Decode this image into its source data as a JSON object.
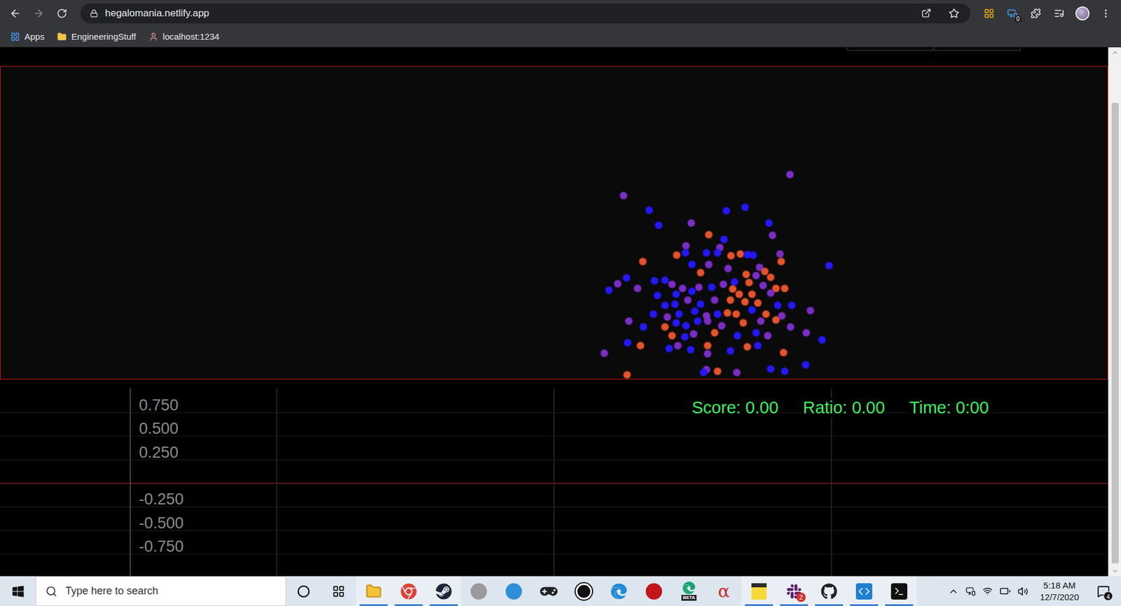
{
  "browser": {
    "url": "hegalomania.netlify.app",
    "extension_badge": "0",
    "bookmarks": [
      {
        "label": "Apps",
        "kind": "apps"
      },
      {
        "label": "EngineeringStuff",
        "kind": "folder"
      },
      {
        "label": "localhost:1234",
        "kind": "site"
      }
    ]
  },
  "page": {
    "top_buttons": 2
  },
  "simulation": {
    "particles": [
      [
        1105,
        152,
        "#7a2ec4"
      ],
      [
        872,
        181,
        "#7a2ec4"
      ],
      [
        908,
        202,
        "#2418f5"
      ],
      [
        1016,
        203,
        "#2418f5"
      ],
      [
        1042,
        198,
        "#2418f5"
      ],
      [
        921,
        223,
        "#2418f5"
      ],
      [
        967,
        220,
        "#7a2ec4"
      ],
      [
        1076,
        220,
        "#2418f5"
      ],
      [
        1081,
        237,
        "#7a2ec4"
      ],
      [
        992,
        236,
        "#e4532c"
      ],
      [
        1013,
        243,
        "#2418f5"
      ],
      [
        960,
        252,
        "#7a2ec4"
      ],
      [
        1007,
        254,
        "#7a2ec4"
      ],
      [
        988,
        262,
        "#2418f5"
      ],
      [
        1004,
        262,
        "#2418f5"
      ],
      [
        947,
        265,
        "#e4532c"
      ],
      [
        959,
        262,
        "#2418f5"
      ],
      [
        1023,
        266,
        "#e4532c"
      ],
      [
        1036,
        263,
        "#e4532c"
      ],
      [
        1054,
        265,
        "#2418f5"
      ],
      [
        1046,
        264,
        "#2418f5"
      ],
      [
        1091,
        263,
        "#7a2ec4"
      ],
      [
        1093,
        274,
        "#e4532c"
      ],
      [
        899,
        274,
        "#e4532c"
      ],
      [
        1160,
        280,
        "#2418f5"
      ],
      [
        968,
        278,
        "#2418f5"
      ],
      [
        992,
        278,
        "#7a2ec4"
      ],
      [
        1019,
        284,
        "#7a2ec4"
      ],
      [
        1063,
        282,
        "#7a2ec4"
      ],
      [
        1070,
        288,
        "#e4532c"
      ],
      [
        980,
        290,
        "#e4532c"
      ],
      [
        1044,
        292,
        "#e4532c"
      ],
      [
        1058,
        294,
        "#7a2ec4"
      ],
      [
        1078,
        296,
        "#e4532c"
      ],
      [
        876,
        297,
        "#2418f5"
      ],
      [
        864,
        305,
        "#7a2ec4"
      ],
      [
        852,
        314,
        "#2418f5"
      ],
      [
        892,
        312,
        "#7a2ec4"
      ],
      [
        916,
        301,
        "#2418f5"
      ],
      [
        930,
        300,
        "#2418f5"
      ],
      [
        940,
        306,
        "#7a2ec4"
      ],
      [
        955,
        312,
        "#7a2ec4"
      ],
      [
        968,
        316,
        "#2418f5"
      ],
      [
        978,
        310,
        "#7a2ec4"
      ],
      [
        996,
        310,
        "#2418f5"
      ],
      [
        1012,
        306,
        "#7a2ec4"
      ],
      [
        1028,
        303,
        "#2418f5"
      ],
      [
        1048,
        304,
        "#e4532c"
      ],
      [
        1068,
        308,
        "#7a2ec4"
      ],
      [
        1086,
        312,
        "#e4532c"
      ],
      [
        1098,
        312,
        "#e4532c"
      ],
      [
        1025,
        313,
        "#e4532c"
      ],
      [
        1034,
        320,
        "#e4532c"
      ],
      [
        1052,
        320,
        "#e4532c"
      ],
      [
        1078,
        318,
        "#7a2ec4"
      ],
      [
        920,
        322,
        "#2418f5"
      ],
      [
        946,
        320,
        "#2418f5"
      ],
      [
        930,
        336,
        "#2418f5"
      ],
      [
        944,
        334,
        "#2418f5"
      ],
      [
        962,
        328,
        "#7a2ec4"
      ],
      [
        980,
        334,
        "#2418f5"
      ],
      [
        1000,
        328,
        "#7a2ec4"
      ],
      [
        1022,
        328,
        "#e4532c"
      ],
      [
        1042,
        331,
        "#e4532c"
      ],
      [
        1060,
        332,
        "#e4532c"
      ],
      [
        1088,
        336,
        "#2418f5"
      ],
      [
        1108,
        336,
        "#2418f5"
      ],
      [
        1134,
        343,
        "#7a2ec4"
      ],
      [
        914,
        348,
        "#2418f5"
      ],
      [
        934,
        352,
        "#7a2ec4"
      ],
      [
        950,
        348,
        "#2418f5"
      ],
      [
        972,
        344,
        "#2418f5"
      ],
      [
        988,
        350,
        "#7a2ec4"
      ],
      [
        1004,
        348,
        "#2418f5"
      ],
      [
        1018,
        346,
        "#e4532c"
      ],
      [
        1030,
        348,
        "#e4532c"
      ],
      [
        1052,
        342,
        "#2418f5"
      ],
      [
        1072,
        348,
        "#e4532c"
      ],
      [
        1094,
        350,
        "#7a2ec4"
      ],
      [
        880,
        358,
        "#7a2ec4"
      ],
      [
        900,
        366,
        "#2418f5"
      ],
      [
        930,
        366,
        "#e4532c"
      ],
      [
        946,
        360,
        "#2418f5"
      ],
      [
        960,
        364,
        "#2418f5"
      ],
      [
        976,
        358,
        "#2418f5"
      ],
      [
        990,
        358,
        "#7a2ec4"
      ],
      [
        1010,
        364,
        "#7a2ec4"
      ],
      [
        1040,
        360,
        "#e4532c"
      ],
      [
        1064,
        358,
        "#7a2ec4"
      ],
      [
        1086,
        356,
        "#e4532c"
      ],
      [
        1106,
        366,
        "#7a2ec4"
      ],
      [
        1128,
        374,
        "#7a2ec4"
      ],
      [
        940,
        378,
        "#e4532c"
      ],
      [
        958,
        380,
        "#2418f5"
      ],
      [
        970,
        376,
        "#7a2ec4"
      ],
      [
        1000,
        374,
        "#e4532c"
      ],
      [
        1032,
        378,
        "#2418f5"
      ],
      [
        1058,
        374,
        "#2418f5"
      ],
      [
        1074,
        378,
        "#7a2ec4"
      ],
      [
        1150,
        384,
        "#2418f5"
      ],
      [
        878,
        388,
        "#2418f5"
      ],
      [
        896,
        392,
        "#e4532c"
      ],
      [
        936,
        396,
        "#2418f5"
      ],
      [
        948,
        392,
        "#7a2ec4"
      ],
      [
        966,
        398,
        "#2418f5"
      ],
      [
        990,
        392,
        "#e4532c"
      ],
      [
        1022,
        400,
        "#2418f5"
      ],
      [
        1046,
        394,
        "#e4532c"
      ],
      [
        1060,
        392,
        "#2418f5"
      ],
      [
        1096,
        402,
        "#e4532c"
      ],
      [
        845,
        403,
        "#7a2ec4"
      ],
      [
        990,
        404,
        "#7a2ec4"
      ],
      [
        1127,
        419,
        "#2418f5"
      ],
      [
        877,
        433,
        "#e4532c"
      ],
      [
        988,
        426,
        "#7a2ec4"
      ],
      [
        1004,
        428,
        "#e4532c"
      ],
      [
        1031,
        430,
        "#7a2ec4"
      ],
      [
        1078,
        425,
        "#2418f5"
      ],
      [
        1098,
        428,
        "#2418f5"
      ],
      [
        984,
        430,
        "#2418f5"
      ]
    ]
  },
  "stats": [
    {
      "label": "Score: 0.00"
    },
    {
      "label": "Ratio: 0.00"
    },
    {
      "label": "Time: 0:00"
    }
  ],
  "chart": {
    "ticks": [
      {
        "label": "0.750",
        "value": 0.75
      },
      {
        "label": "0.500",
        "value": 0.5
      },
      {
        "label": "0.250",
        "value": 0.25
      },
      {
        "label": "-0.250",
        "value": -0.25
      },
      {
        "label": "-0.500",
        "value": -0.5
      },
      {
        "label": "-0.750",
        "value": -0.75
      }
    ],
    "series": []
  },
  "taskbar": {
    "search_placeholder": "Type here to search",
    "apps": [
      {
        "name": "cortana",
        "kind": "cortana",
        "running": false,
        "color": "#111111"
      },
      {
        "name": "task-view",
        "kind": "taskview",
        "running": false,
        "color": "#111111"
      },
      {
        "name": "file-explorer",
        "kind": "folder",
        "running": true,
        "color": "#f3c13a"
      },
      {
        "name": "chrome",
        "kind": "chrome",
        "running": true,
        "color": "#db4437"
      },
      {
        "name": "steam",
        "kind": "steam",
        "running": true,
        "color": "#1b2838"
      },
      {
        "name": "infinity-app",
        "kind": "dot",
        "running": false,
        "color": "#9a9a9a"
      },
      {
        "name": "bird-app",
        "kind": "dot",
        "running": false,
        "color": "#2f8fd8"
      },
      {
        "name": "gamepad-app",
        "kind": "gamepad",
        "running": false,
        "color": "#222222"
      },
      {
        "name": "unreal",
        "kind": "ring",
        "running": false,
        "color": "#111111"
      },
      {
        "name": "edge",
        "kind": "edge",
        "running": false,
        "color": "#1f8ad6"
      },
      {
        "name": "red-app",
        "kind": "dot",
        "running": false,
        "color": "#c0161c"
      },
      {
        "name": "edge-beta",
        "kind": "edgebeta",
        "running": false,
        "color": "#1aa36b",
        "glyph": "BETA"
      },
      {
        "name": "alpha-app",
        "kind": "glyph",
        "running": false,
        "color": "#c62828",
        "glyph": "α"
      },
      {
        "name": "sticky-notes",
        "kind": "sticky",
        "running": true,
        "color": "#f7d83a"
      },
      {
        "name": "slack",
        "kind": "slack",
        "running": true,
        "color": "#611f69",
        "badge": "2"
      },
      {
        "name": "github",
        "kind": "github",
        "running": true,
        "color": "#222222"
      },
      {
        "name": "vscode",
        "kind": "vscode",
        "running": true,
        "color": "#1f7fd1"
      },
      {
        "name": "terminal",
        "kind": "terminal",
        "running": true,
        "color": "#111111"
      }
    ],
    "clock": {
      "time": "5:18 AM",
      "date": "12/7/2020"
    },
    "notifications": "4"
  }
}
